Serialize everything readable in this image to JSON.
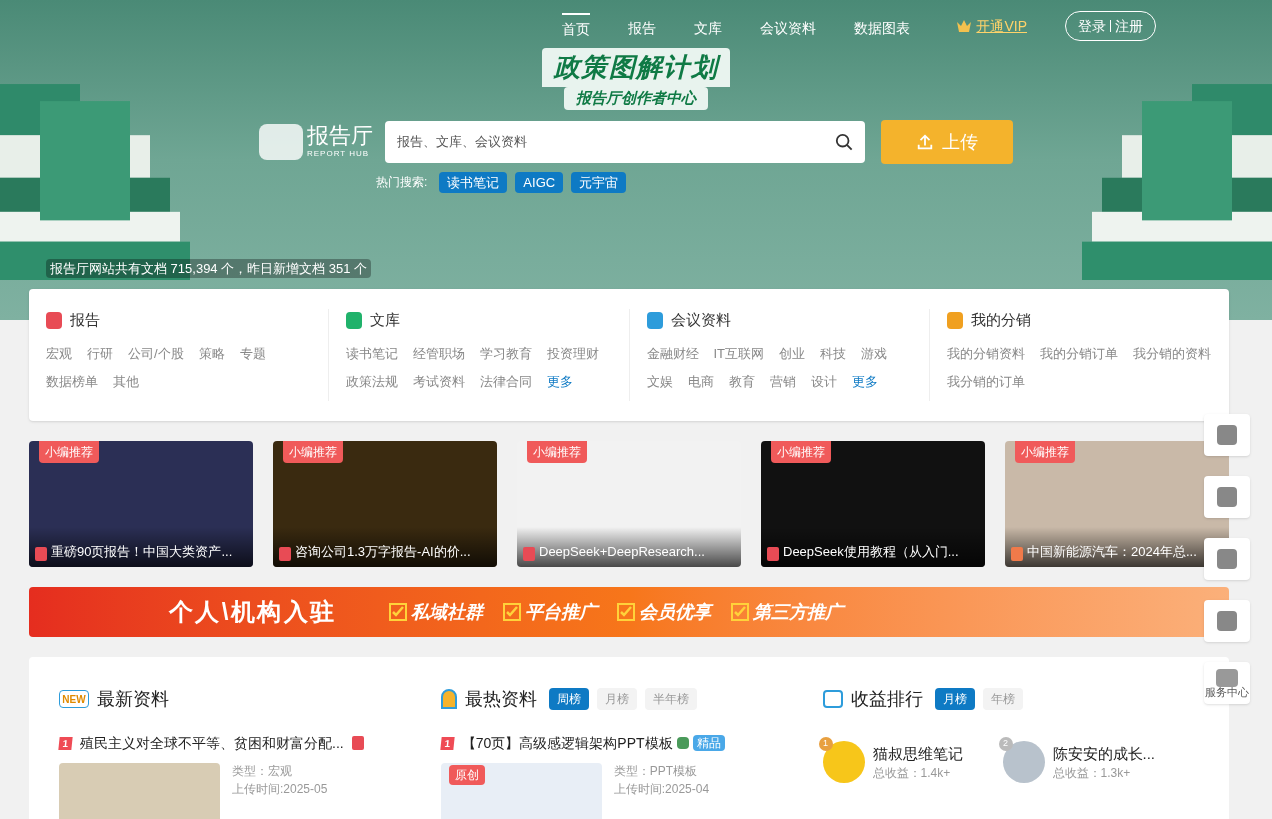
{
  "nav": {
    "items": [
      {
        "label": "首页",
        "selected": true
      },
      {
        "label": "报告",
        "selected": false
      },
      {
        "label": "文库",
        "selected": false
      },
      {
        "label": "会议资料",
        "selected": false
      },
      {
        "label": "数据图表",
        "selected": false
      }
    ],
    "vip": "开通VIP",
    "login": "登录",
    "register": "注册"
  },
  "hero": {
    "headline": "政策图解计划",
    "subline": "报告厅创作者中心",
    "logo": {
      "name": "报告厅",
      "tagline": "REPORT HUB"
    },
    "search": {
      "placeholder": "报告、文库、会议资料"
    },
    "upload": "上传",
    "hot_label": "热门搜索:",
    "hot_tags": [
      "读书笔记",
      "AIGC",
      "元宇宙"
    ],
    "stats": "报告厅网站共有文档 715,394 个，昨日新增文档 351 个"
  },
  "categories": [
    {
      "kind": "report",
      "title": "报告",
      "links": [
        {
          "label": "宏观",
          "more": false
        },
        {
          "label": "行研",
          "more": false
        },
        {
          "label": "公司/个股",
          "more": false
        },
        {
          "label": "策略",
          "more": false
        },
        {
          "label": "专题",
          "more": false
        },
        {
          "label": "数据榜单",
          "more": false
        },
        {
          "label": "其他",
          "more": false
        }
      ]
    },
    {
      "kind": "library",
      "title": "文库",
      "links": [
        {
          "label": "读书笔记",
          "more": false
        },
        {
          "label": "经管职场",
          "more": false
        },
        {
          "label": "学习教育",
          "more": false
        },
        {
          "label": "投资理财",
          "more": false
        },
        {
          "label": "政策法规",
          "more": false
        },
        {
          "label": "考试资料",
          "more": false
        },
        {
          "label": "法律合同",
          "more": false
        },
        {
          "label": "更多",
          "more": true
        }
      ]
    },
    {
      "kind": "meeting",
      "title": "会议资料",
      "links": [
        {
          "label": "金融财经",
          "more": false
        },
        {
          "label": "IT互联网",
          "more": false
        },
        {
          "label": "创业",
          "more": false
        },
        {
          "label": "科技",
          "more": false
        },
        {
          "label": "游戏",
          "more": false
        },
        {
          "label": "文娱",
          "more": false
        },
        {
          "label": "电商",
          "more": false
        },
        {
          "label": "教育",
          "more": false
        },
        {
          "label": "营销",
          "more": false
        },
        {
          "label": "设计",
          "more": false
        },
        {
          "label": "更多",
          "more": true
        }
      ]
    },
    {
      "kind": "distribution",
      "title": "我的分销",
      "links": [
        {
          "label": "我的分销资料",
          "more": false
        },
        {
          "label": "我的分销订单",
          "more": false
        },
        {
          "label": "我分销的资料",
          "more": false
        },
        {
          "label": "我分销的订单",
          "more": false
        }
      ]
    }
  ],
  "featured": [
    {
      "badge": "小编推荐",
      "title": "重磅90页报告！中国大类资产...",
      "kind": "pdf"
    },
    {
      "badge": "小编推荐",
      "title": "咨询公司1.3万字报告-AI的价...",
      "kind": "pdf"
    },
    {
      "badge": "小编推荐",
      "title": "DeepSeek+DeepResearch...",
      "kind": "pdf"
    },
    {
      "badge": "小编推荐",
      "title": "DeepSeek使用教程（从入门...",
      "kind": "pdf"
    },
    {
      "badge": "小编推荐",
      "title": "中国新能源汽车：2024年总...",
      "kind": "ppt"
    }
  ],
  "promo": {
    "title": "个人\\机构入驻",
    "benefits": [
      "私域社群",
      "平台推广",
      "会员优享",
      "第三方推广"
    ]
  },
  "latest": {
    "title": "最新资料",
    "icon_text": "NEW",
    "items": [
      {
        "rank": "1",
        "title": "殖民主义对全球不平等、贫困和财富分配...",
        "kind": "pdf",
        "type": "类型：宏观",
        "time": "上传时间:2025-05"
      }
    ]
  },
  "hottest": {
    "title": "最热资料",
    "tabs": [
      {
        "label": "周榜",
        "selected": true
      },
      {
        "label": "月榜",
        "selected": false
      },
      {
        "label": "半年榜",
        "selected": false
      }
    ],
    "items": [
      {
        "rank": "1",
        "title": "【70页】高级感逻辑架构PPT模板",
        "badge": "精品",
        "tag": "原创",
        "type": "类型：PPT模板",
        "time": "上传时间:2025-04"
      }
    ]
  },
  "earnings": {
    "title": "收益排行",
    "tabs": [
      {
        "label": "月榜",
        "selected": true
      },
      {
        "label": "年榜",
        "selected": false
      }
    ],
    "people": [
      {
        "rank": "1",
        "name": "猫叔思维笔记",
        "income": "总收益：1.4k+"
      },
      {
        "rank": "2",
        "name": "陈安安的成长...",
        "income": "总收益：1.3k+"
      }
    ]
  },
  "side_tools": {
    "service_label": "服务中心"
  }
}
